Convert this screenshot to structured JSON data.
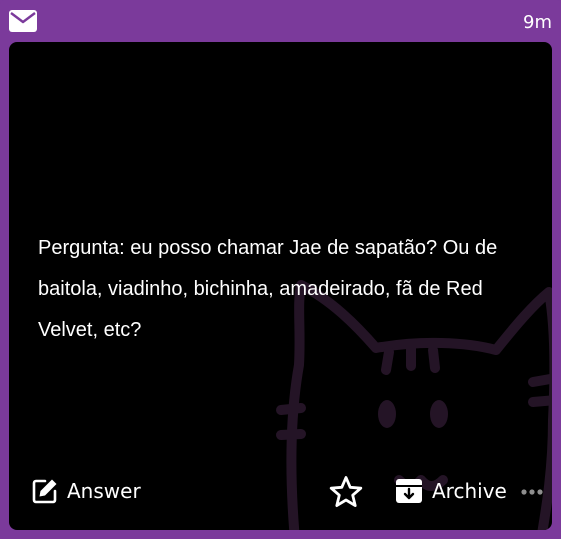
{
  "header": {
    "icon": "mail-icon",
    "time_ago": "9m"
  },
  "message": {
    "question": "Pergunta: eu posso chamar Jae de sapatão? Ou de baitola, viadinho, bichinha, amadeirado, fã de Red Velvet, etc?"
  },
  "actions": {
    "answer_label": "Answer",
    "archive_label": "Archive"
  },
  "colors": {
    "frame": "#7b3a9b",
    "card": "#000000",
    "text": "#ffffff",
    "cat_watermark": "#241426"
  }
}
